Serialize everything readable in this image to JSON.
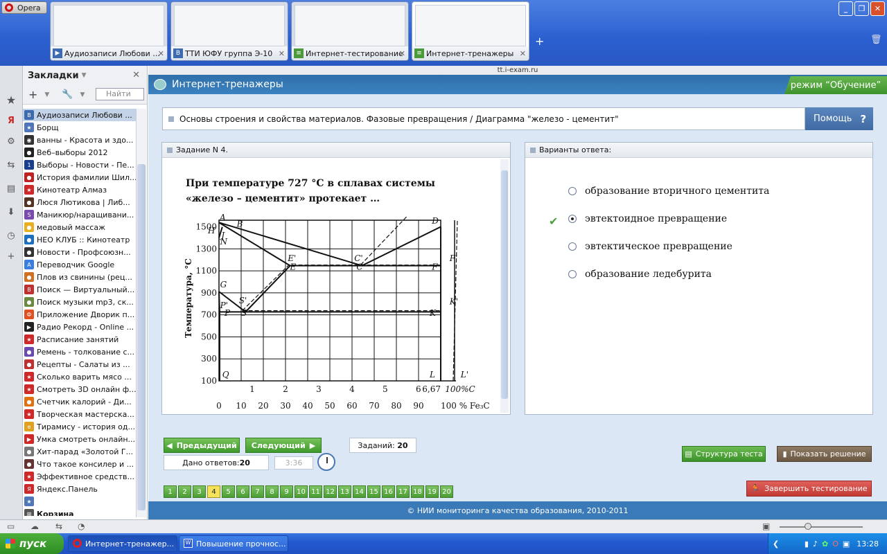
{
  "browser": {
    "menu_label": "Opera",
    "address": "tt.i-exam.ru",
    "tabs": [
      {
        "title": "Аудиозаписи Любови ...",
        "icon": "vk-icon"
      },
      {
        "title": "ТТИ ЮФУ группа Э-10",
        "icon": "vk-icon"
      },
      {
        "title": "Интернет-тестирование",
        "icon": "iexam-icon"
      },
      {
        "title": "Интернет-тренажеры",
        "icon": "iexam-icon"
      }
    ],
    "new_tab": "+"
  },
  "bookmarks": {
    "title": "Закладки",
    "search_placeholder": "Найти",
    "items": [
      {
        "label": "Аудиозаписи Любови ...",
        "color": "#3d6bb0",
        "g": "B"
      },
      {
        "label": "Борщ",
        "color": "#4e76b8",
        "g": "★"
      },
      {
        "label": "ванны - Красота и здо...",
        "color": "#333333",
        "g": "◉"
      },
      {
        "label": "Веб–выборы 2012",
        "color": "#222222",
        "g": "●"
      },
      {
        "label": "Выборы - Новости - Пе...",
        "color": "#1a3f8f",
        "g": "1"
      },
      {
        "label": "История фамилии Шил...",
        "color": "#c02020",
        "g": "●"
      },
      {
        "label": "Кинотеатр Алмаз",
        "color": "#d02828",
        "g": "★"
      },
      {
        "label": "Люся Лютикова | Либ...",
        "color": "#553322",
        "g": "●"
      },
      {
        "label": "Маникюр/наращивани...",
        "color": "#7a4ab0",
        "g": "S"
      },
      {
        "label": "медовый массаж",
        "color": "#e8b020",
        "g": "●"
      },
      {
        "label": "НЕО КЛУБ :: Кинотеатр",
        "color": "#1a6fc0",
        "g": "●"
      },
      {
        "label": "Новости - Профсоюзн...",
        "color": "#333333",
        "g": "●"
      },
      {
        "label": "Переводчик Google",
        "color": "#3a7ee0",
        "g": "A"
      },
      {
        "label": "Плов из свинины (рец...",
        "color": "#d07020",
        "g": "●"
      },
      {
        "label": "Поиск — Виртуальный...",
        "color": "#c03030",
        "g": "B"
      },
      {
        "label": "Поиск музыки mp3, ск...",
        "color": "#6a8a40",
        "g": "●"
      },
      {
        "label": "Приложение Дворик п...",
        "color": "#e05020",
        "g": "Ф"
      },
      {
        "label": "Радио Рекорд - Online ...",
        "color": "#222222",
        "g": "▶"
      },
      {
        "label": "Расписание занятий",
        "color": "#d02828",
        "g": "★"
      },
      {
        "label": "Ремень - толкование с...",
        "color": "#6a4ab0",
        "g": "●"
      },
      {
        "label": "Рецепты - Салаты из ...",
        "color": "#c03030",
        "g": "●"
      },
      {
        "label": "Сколько варить мясо ...",
        "color": "#d02828",
        "g": "★"
      },
      {
        "label": "Смотреть 3D онлайн ф...",
        "color": "#d02828",
        "g": "★"
      },
      {
        "label": "Счетчик калорий - Ди...",
        "color": "#e07010",
        "g": "●"
      },
      {
        "label": "Творческая мастерска...",
        "color": "#d02828",
        "g": "★"
      },
      {
        "label": "Тирамису - история од...",
        "color": "#e0a020",
        "g": "e"
      },
      {
        "label": "Умка смотреть онлайн...",
        "color": "#d02828",
        "g": "▶"
      },
      {
        "label": "Хит-парад «Золотой Г...",
        "color": "#777777",
        "g": "●"
      },
      {
        "label": "Что такое консилер и ...",
        "color": "#663333",
        "g": "●"
      },
      {
        "label": "Эффективное средств...",
        "color": "#d02828",
        "g": "★"
      },
      {
        "label": "Яндекс.Панель",
        "color": "#d02828",
        "g": "Я"
      },
      {
        "label": "",
        "color": "#4e76b8",
        "g": "★"
      },
      {
        "label": "Корзина",
        "color": "#555555",
        "g": "⊞"
      }
    ]
  },
  "page": {
    "header_title": "Интернет-тренажеры",
    "mode_label": "режим “Обучение”",
    "breadcrumb": "Основы строения и свойства материалов. Фазовые превращения / Диаграмма \"железо - цементит\"",
    "help_label": "Помощь",
    "help_icon": "?",
    "task_header": "Задание N 4.",
    "question": "При температуре 727 °С в сплавах системы «железо – цементит» протекает …",
    "answers_header": "Варианты ответа:",
    "answers": [
      {
        "text": "образование вторичного цементита",
        "selected": false
      },
      {
        "text": "эвтектоидное превращение",
        "selected": true
      },
      {
        "text": "эвтектическое превращение",
        "selected": false
      },
      {
        "text": "образование ледебурита",
        "selected": false
      }
    ],
    "prev_label": "Предыдущий",
    "next_label": "Следующий",
    "tasks_label": "Заданий:",
    "tasks_count": "20",
    "answered_label": "Дано ответов:",
    "answered_count": "20",
    "timer": "3:36",
    "structure_label": "Структура теста",
    "solution_label": "Показать решение",
    "finish_label": "Завершить тестирование",
    "pages": [
      "1",
      "2",
      "3",
      "4",
      "5",
      "6",
      "7",
      "8",
      "9",
      "10",
      "11",
      "12",
      "13",
      "14",
      "15",
      "16",
      "17",
      "18",
      "19",
      "20"
    ],
    "current_page": "4",
    "footer": "© НИИ мониторинга качества образования, 2010-2011"
  },
  "diagram": {
    "y_axis_label": "Температура, °С",
    "y_ticks": [
      "1500",
      "1300",
      "1100",
      "900",
      "700",
      "500",
      "300",
      "100"
    ],
    "x_ticks_c": [
      "1",
      "2",
      "3",
      "4",
      "5",
      "6",
      "6,67",
      "100%С"
    ],
    "x_ticks_fe3c": [
      "0",
      "10",
      "20",
      "30",
      "40",
      "50",
      "60",
      "70",
      "80",
      "90",
      "100 % Fe₃C"
    ],
    "points": [
      "A",
      "B",
      "H",
      "J",
      "N",
      "D",
      "E'",
      "C'",
      "F'",
      "E",
      "C",
      "F",
      "G",
      "S'",
      "K'",
      "P'",
      "P",
      "S",
      "K",
      "Q",
      "L",
      "L'"
    ]
  },
  "taskbar": {
    "start_label": "пуск",
    "items": [
      "Интернет-тренажер...",
      "Повышение прочнос..."
    ],
    "clock": "13:28"
  }
}
